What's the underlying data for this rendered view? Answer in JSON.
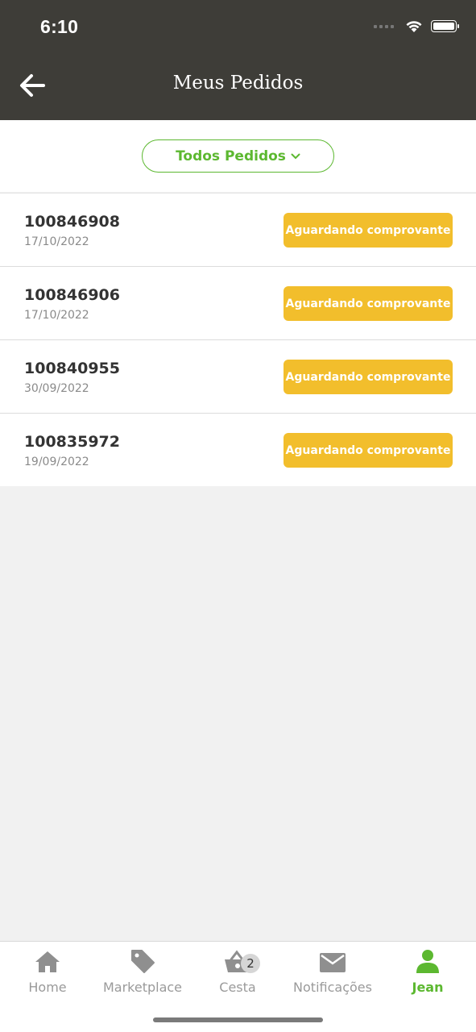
{
  "status_bar": {
    "time": "6:10"
  },
  "header": {
    "title": "Meus Pedidos",
    "back_icon": "arrow-left-icon"
  },
  "filter": {
    "label": "Todos Pedidos",
    "icon": "chevron-down-icon",
    "accent": "#5cb830"
  },
  "orders": [
    {
      "id": "100846908",
      "date": "17/10/2022",
      "status": "Aguardando comprovante"
    },
    {
      "id": "100846906",
      "date": "17/10/2022",
      "status": "Aguardando comprovante"
    },
    {
      "id": "100840955",
      "date": "30/09/2022",
      "status": "Aguardando comprovante"
    },
    {
      "id": "100835972",
      "date": "19/09/2022",
      "status": "Aguardando comprovante"
    }
  ],
  "status_color": "#f2be2c",
  "bottom_nav": {
    "items": [
      {
        "label": "Home",
        "icon": "home-icon"
      },
      {
        "label": "Marketplace",
        "icon": "tag-icon"
      },
      {
        "label": "Cesta",
        "icon": "basket-icon",
        "badge": "2"
      },
      {
        "label": "Notificações",
        "icon": "mail-icon"
      },
      {
        "label": "Jean",
        "icon": "user-icon",
        "active": true
      }
    ]
  }
}
